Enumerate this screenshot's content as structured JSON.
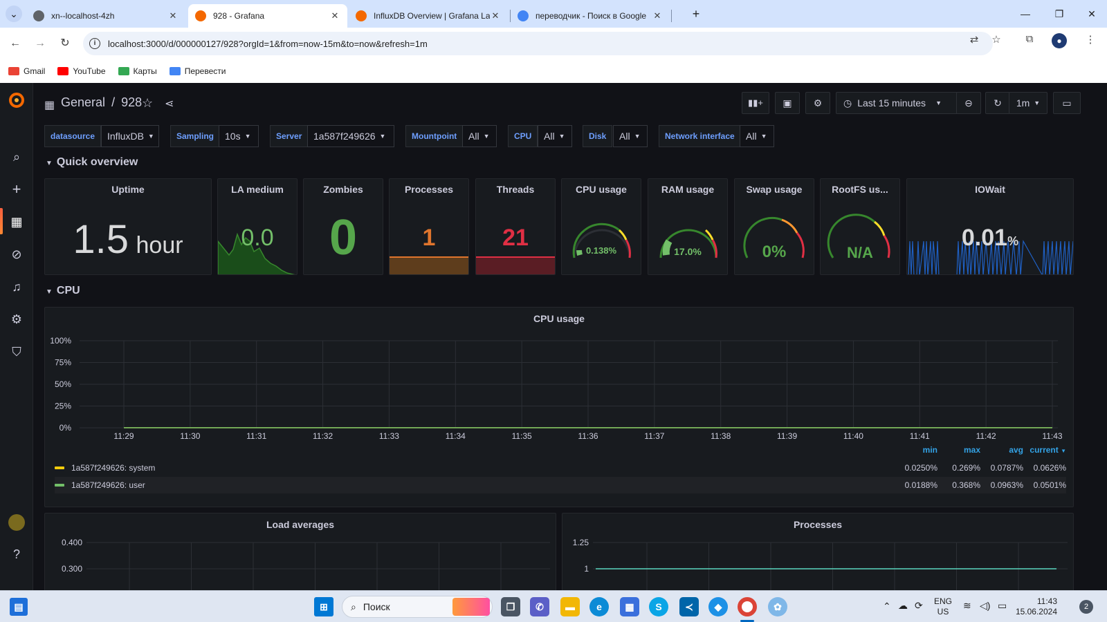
{
  "browser": {
    "tabs": [
      {
        "title": "xn--localhost-4zh",
        "icon_color": "#5f6368"
      },
      {
        "title": "928 - Grafana",
        "icon_color": "#f46800"
      },
      {
        "title": "InfluxDB Overview | Grafana Lal",
        "icon_color": "#f46800"
      },
      {
        "title": "переводчик - Поиск в Google",
        "icon_color": "#4285f4"
      }
    ],
    "url": "localhost:3000/d/000000127/928?orgId=1&from=now-15m&to=now&refresh=1m",
    "bookmarks": [
      {
        "label": "Gmail",
        "color": "#ea4335"
      },
      {
        "label": "YouTube",
        "color": "#ff0000"
      },
      {
        "label": "Карты",
        "color": "#34a853"
      },
      {
        "label": "Перевести",
        "color": "#4285f4"
      }
    ]
  },
  "grafana": {
    "breadcrumb_folder": "General",
    "breadcrumb_sep": "/",
    "dashboard_title": "928",
    "time_range": "Last 15 minutes",
    "refresh_interval": "1m",
    "variables": [
      {
        "label": "datasource",
        "value": "InfluxDB"
      },
      {
        "label": "Sampling",
        "value": "10s"
      },
      {
        "label": "Server",
        "value": "1a587f249626"
      },
      {
        "label": "Mountpoint",
        "value": "All"
      },
      {
        "label": "CPU",
        "value": "All"
      },
      {
        "label": "Disk",
        "value": "All"
      },
      {
        "label": "Network interface",
        "value": "All"
      }
    ],
    "rows": {
      "quick_overview": "Quick overview",
      "cpu": "CPU"
    },
    "stats": {
      "uptime": {
        "title": "Uptime",
        "value": "1.5",
        "unit": "hour"
      },
      "la_medium": {
        "title": "LA medium",
        "value": "0.0"
      },
      "zombies": {
        "title": "Zombies",
        "value": "0"
      },
      "processes": {
        "title": "Processes",
        "value": "1"
      },
      "threads": {
        "title": "Threads",
        "value": "21"
      },
      "cpu_usage": {
        "title": "CPU usage",
        "value": "0.138%",
        "fraction": 0.00138
      },
      "ram_usage": {
        "title": "RAM usage",
        "value": "17.0%",
        "fraction": 0.17
      },
      "swap_usage": {
        "title": "Swap usage",
        "value": "0%",
        "fraction": 0
      },
      "rootfs_usage": {
        "title": "RootFS us...",
        "value": "N/A",
        "fraction": 0
      },
      "iowait": {
        "title": "IOWait",
        "value": "0.01",
        "unit": "%"
      }
    },
    "cpu_panel": {
      "title": "CPU usage",
      "legend_headers": {
        "min": "min",
        "max": "max",
        "avg": "avg",
        "current": "current"
      },
      "legend": [
        {
          "name": "1a587f249626: system",
          "color": "#f2cc0c",
          "min": "0.0250%",
          "max": "0.269%",
          "avg": "0.0787%",
          "current": "0.0626%"
        },
        {
          "name": "1a587f249626: user",
          "color": "#73bf69",
          "min": "0.0188%",
          "max": "0.368%",
          "avg": "0.0963%",
          "current": "0.0501%"
        }
      ]
    },
    "load_panel": {
      "title": "Load averages"
    },
    "processes_panel": {
      "title": "Processes"
    }
  },
  "chart_data": [
    {
      "type": "line",
      "title": "CPU usage",
      "x": [
        "11:29",
        "11:30",
        "11:31",
        "11:32",
        "11:33",
        "11:34",
        "11:35",
        "11:36",
        "11:37",
        "11:38",
        "11:39",
        "11:40",
        "11:41",
        "11:42",
        "11:43"
      ],
      "yticks": [
        "100%",
        "75%",
        "50%",
        "25%",
        "0%"
      ],
      "ylim": [
        0,
        100
      ],
      "series": [
        {
          "name": "1a587f249626: system",
          "values": [
            0.08,
            0.07,
            0.06,
            0.09,
            0.1,
            0.05,
            0.08,
            0.07,
            0.06,
            0.09,
            0.08,
            0.07,
            0.06,
            0.07,
            0.06
          ]
        },
        {
          "name": "1a587f249626: user",
          "values": [
            0.1,
            0.09,
            0.08,
            0.12,
            0.11,
            0.07,
            0.1,
            0.09,
            0.08,
            0.1,
            0.09,
            0.08,
            0.07,
            0.06,
            0.05
          ]
        }
      ]
    },
    {
      "type": "line",
      "title": "Load averages",
      "yticks": [
        "0.400",
        "0.300"
      ]
    },
    {
      "type": "line",
      "title": "Processes",
      "yticks": [
        "1.25",
        "1"
      ]
    }
  ],
  "taskbar": {
    "search_placeholder": "Поиск",
    "lang_line1": "ENG",
    "lang_line2": "US",
    "time": "11:43",
    "date": "15.06.2024",
    "notifications": "2"
  }
}
